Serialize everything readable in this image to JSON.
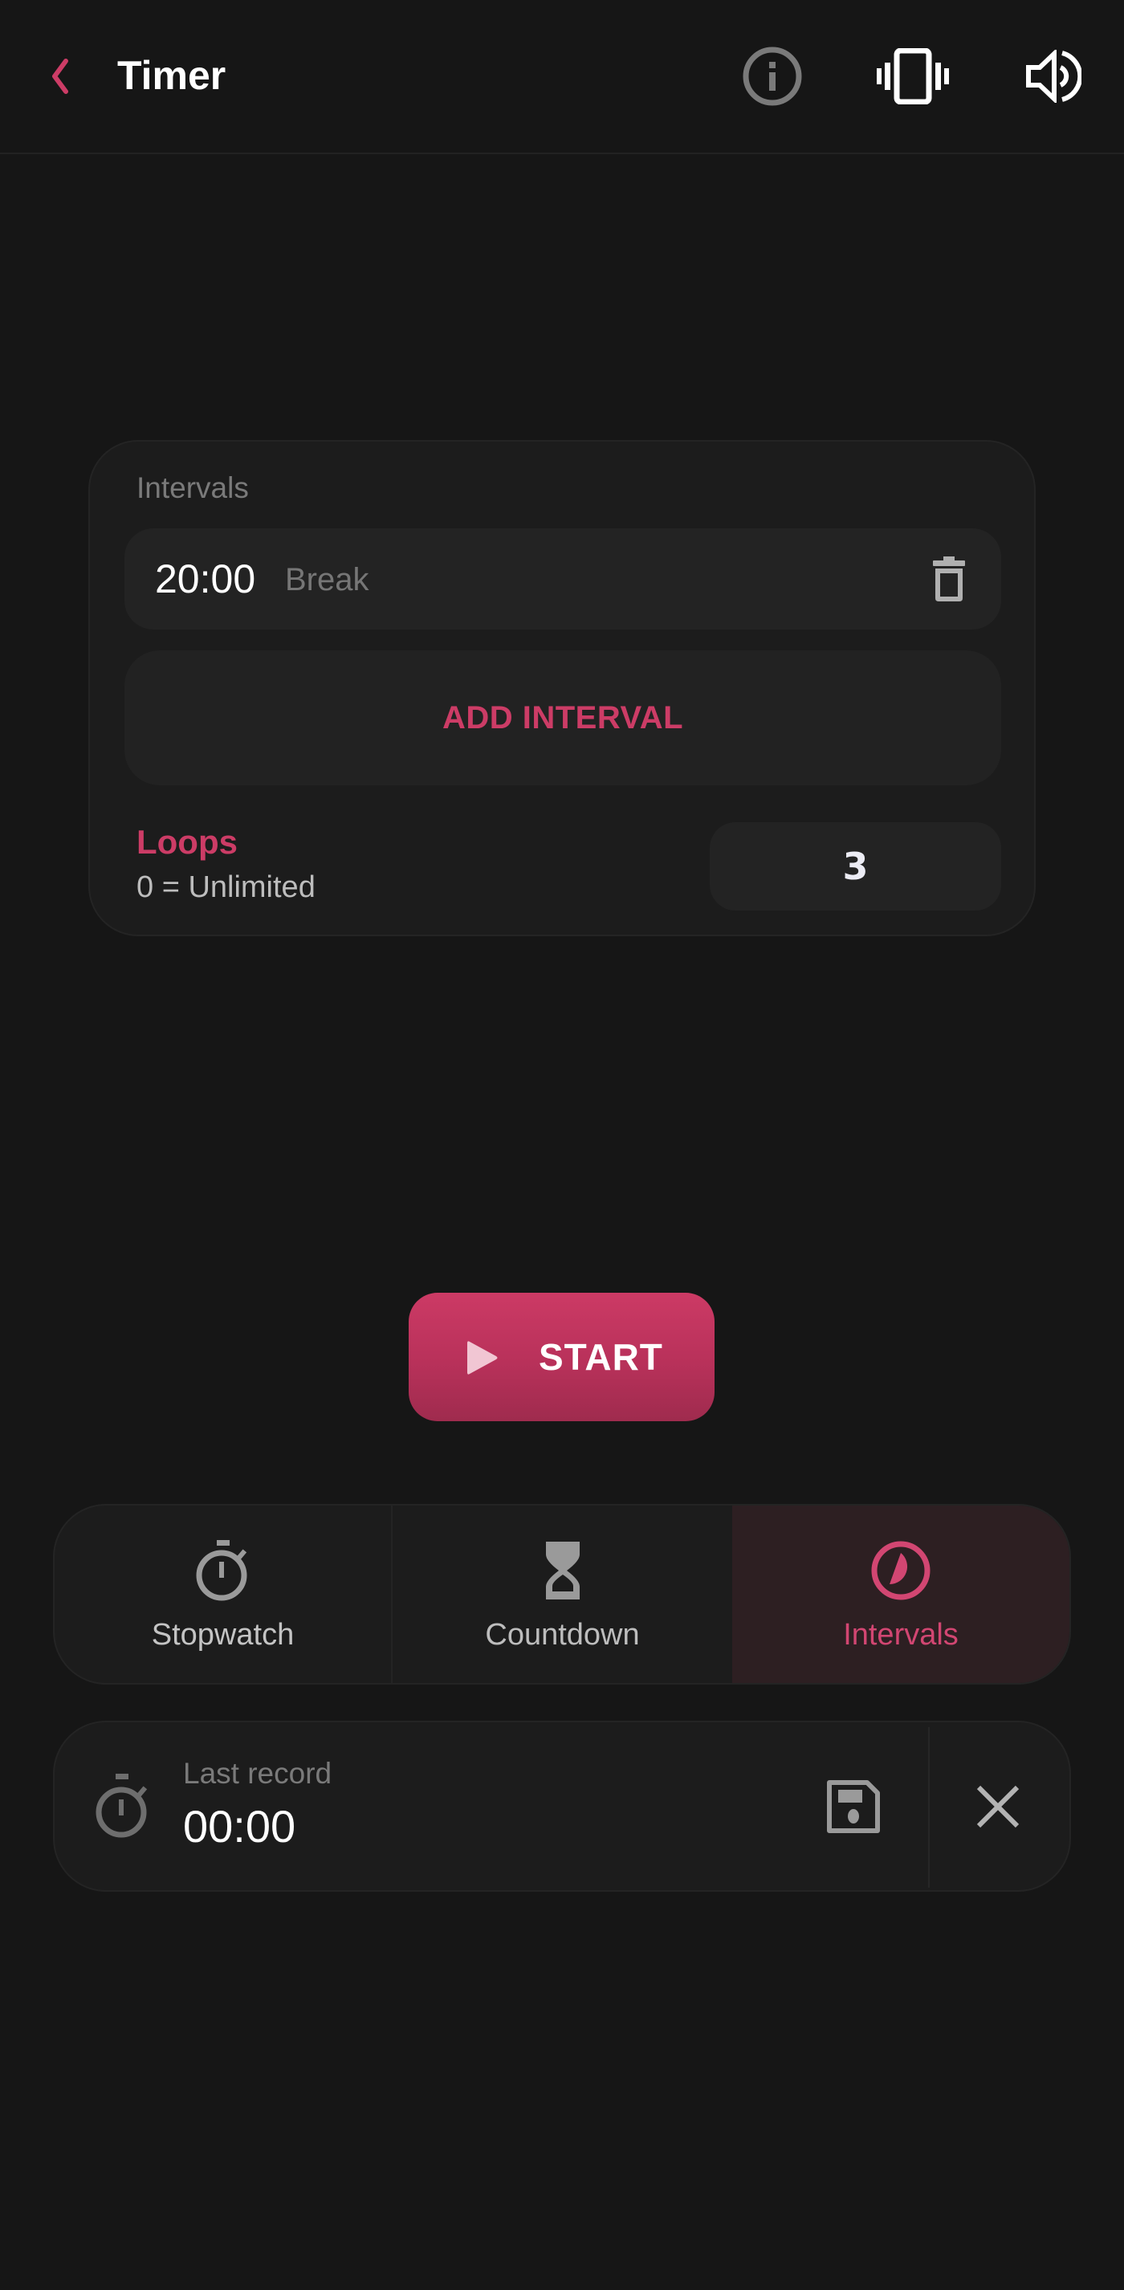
{
  "colors": {
    "accent": "#cc3c66",
    "background": "#161616",
    "card": "#1c1c1c",
    "active_tab_bg": "#2d1f22"
  },
  "header": {
    "title": "Timer",
    "back_icon": "chevron-left-icon",
    "actions": [
      {
        "name": "info",
        "icon": "info-icon"
      },
      {
        "name": "vibration",
        "icon": "vibrate-icon"
      },
      {
        "name": "sound",
        "icon": "volume-icon"
      }
    ]
  },
  "intervals_card": {
    "label": "Intervals",
    "items": [
      {
        "time": "20:00",
        "name": "Break"
      }
    ],
    "add_button_label": "ADD INTERVAL",
    "loops": {
      "label": "Loops",
      "hint": "0 = Unlimited",
      "value": "3"
    }
  },
  "start_button": {
    "label": "START",
    "icon": "play-icon"
  },
  "modes": {
    "tabs": [
      {
        "label": "Stopwatch",
        "icon": "stopwatch-icon",
        "active": false
      },
      {
        "label": "Countdown",
        "icon": "hourglass-icon",
        "active": false
      },
      {
        "label": "Intervals",
        "icon": "intervals-clock-icon",
        "active": true
      }
    ]
  },
  "last_record": {
    "label": "Last record",
    "value": "00:00",
    "icon": "stopwatch-icon",
    "save_icon": "save-icon",
    "close_icon": "close-icon"
  }
}
